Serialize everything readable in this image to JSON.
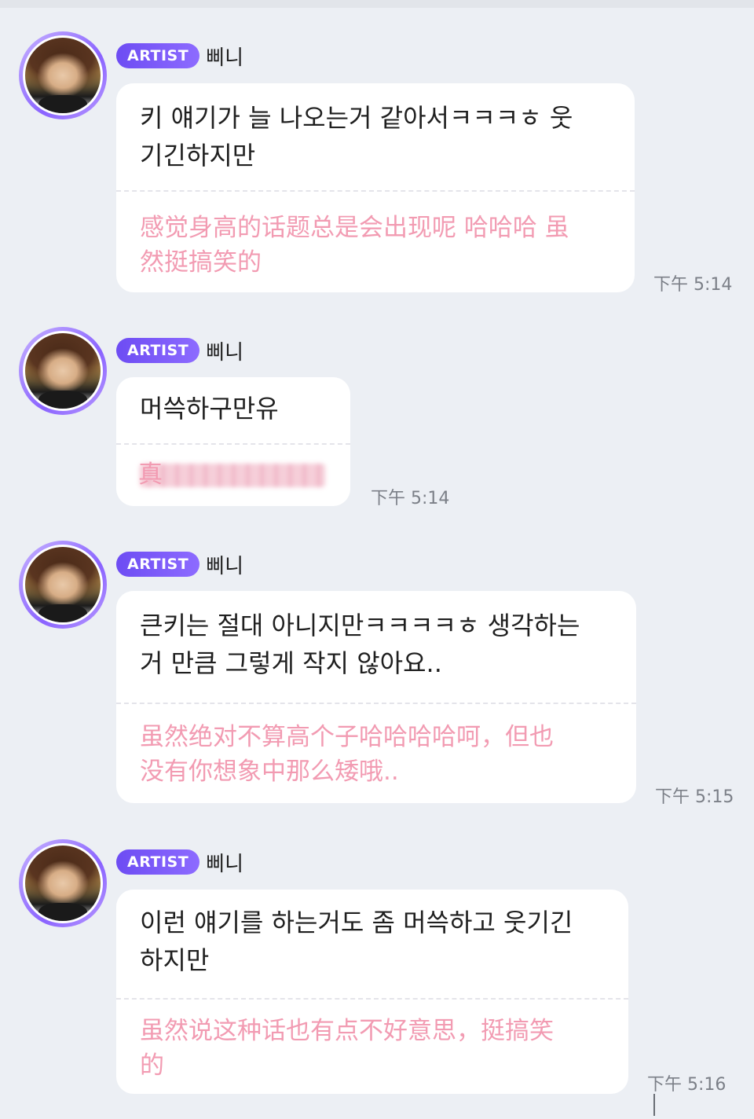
{
  "messages": [
    {
      "badge": "ARTIST",
      "sender": "삐니",
      "korean": "키 얘기가 늘 나오는거 같아서ㅋㅋㅋㅎ 웃\n기긴하지만",
      "translation": "感觉身高的话题总是会出现呢 哈哈哈 虽\n然挺搞笑的",
      "time": "下午 5:14"
    },
    {
      "badge": "ARTIST",
      "sender": "삐니",
      "korean": "머쓱하구만유",
      "translation": "真",
      "translation_blurred": true,
      "time": "下午 5:14"
    },
    {
      "badge": "ARTIST",
      "sender": "삐니",
      "korean": "큰키는 절대 아니지만ㅋㅋㅋㅋㅎ 생각하는\n거 만큼 그렇게 작지 않아요..",
      "translation": "虽然绝对不算高个子哈哈哈哈呵，但也\n没有你想象中那么矮哦..",
      "time": "下午 5:15"
    },
    {
      "badge": "ARTIST",
      "sender": "삐니",
      "korean": "이런 얘기를 하는거도 좀 머쓱하고 웃기긴\n하지만",
      "translation": "虽然说这种话也有点不好意思，挺搞笑\n的",
      "time": "下午 5:16"
    }
  ],
  "colors": {
    "background": "#eceff4",
    "badge": "#7a58f8",
    "translation_text": "#f29bb2",
    "time_text": "#7b7f87"
  }
}
